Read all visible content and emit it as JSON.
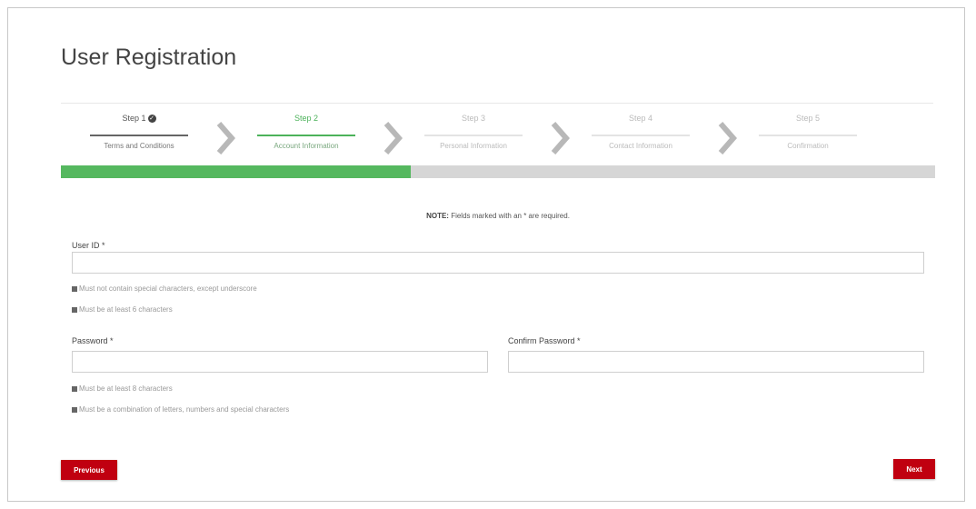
{
  "page": {
    "title": "User Registration"
  },
  "steps": [
    {
      "label": "Step 1",
      "sub": "Terms and Conditions",
      "state": "done"
    },
    {
      "label": "Step 2",
      "sub": "Account Information",
      "state": "active"
    },
    {
      "label": "Step 3",
      "sub": "Personal Information",
      "state": "pending"
    },
    {
      "label": "Step 4",
      "sub": "Contact Information",
      "state": "pending"
    },
    {
      "label": "Step 5",
      "sub": "Confirmation",
      "state": "pending"
    }
  ],
  "progress": {
    "percent": 40,
    "fill_color": "#55b85f"
  },
  "note": {
    "prefix": "NOTE:",
    "text": "Fields marked with an * are required."
  },
  "form": {
    "user_id": {
      "label": "User ID *",
      "value": "",
      "hints": [
        "Must not contain special characters, except underscore",
        "Must be at least 6 characters"
      ]
    },
    "password": {
      "label": "Password *",
      "value": "",
      "hints": [
        "Must be at least 8 characters",
        "Must be a combination of letters, numbers and special characters"
      ]
    },
    "confirm_password": {
      "label": "Confirm Password *",
      "value": ""
    }
  },
  "buttons": {
    "previous": "Previous",
    "next": "Next"
  },
  "colors": {
    "accent_red": "#c00010",
    "accent_green": "#4cb25a"
  }
}
